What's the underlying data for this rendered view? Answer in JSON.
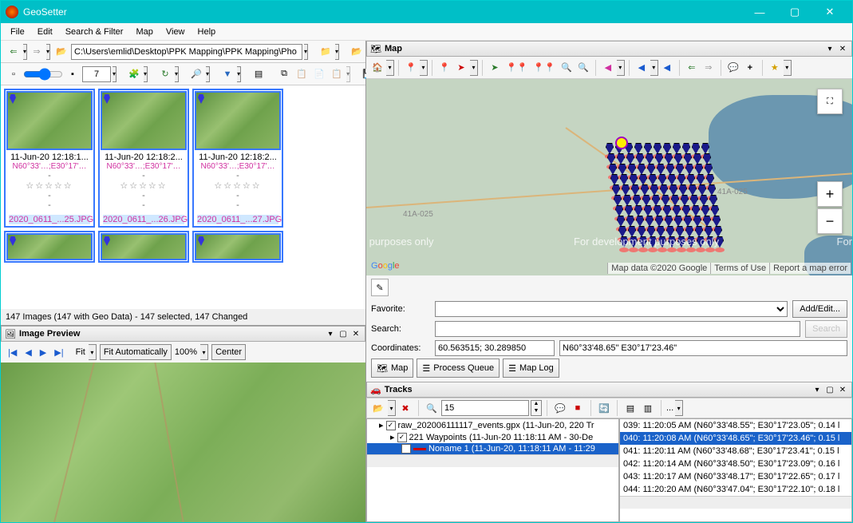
{
  "window": {
    "title": "GeoSetter"
  },
  "menu": [
    "File",
    "Edit",
    "Search & Filter",
    "Map",
    "View",
    "Help"
  ],
  "path_bar": {
    "value": "C:\\Users\\emlid\\Desktop\\PPK Mapping\\PPK Mapping\\Pho"
  },
  "zoom": {
    "value": "7"
  },
  "thumbnails": [
    {
      "date": "11-Jun-20 12:18:1...",
      "geo": "N60°33'…;E30°17'…",
      "file": "2020_0611_...25.JPG"
    },
    {
      "date": "11-Jun-20 12:18:2...",
      "geo": "N60°33'…;E30°17'…",
      "file": "2020_0611_...26.JPG"
    },
    {
      "date": "11-Jun-20 12:18:2...",
      "geo": "N60°33'…;E30°17'…",
      "file": "2020_0611_...27.JPG"
    }
  ],
  "status": "147 Images (147 with Geo Data) - 147 selected, 147 Changed",
  "preview": {
    "header": "Image Preview",
    "fit_label": "Fit",
    "fit_mode": "Fit Automatically",
    "zoom": "100%",
    "center": "Center"
  },
  "map": {
    "header": "Map",
    "road_label": "41A-025",
    "dev_only": "For development purposes only",
    "attrib": [
      "Map data ©2020 Google",
      "Terms of Use",
      "Report a map error"
    ]
  },
  "mid": {
    "favorite_label": "Favorite:",
    "search_label": "Search:",
    "coords_label": "Coordinates:",
    "add_edit": "Add/Edit...",
    "search_btn": "Search",
    "coords_dec": "60.563515; 30.289850",
    "coords_dms": "N60°33'48.65\" E30°17'23.46\"",
    "tab_map": "Map",
    "tab_queue": "Process Queue",
    "tab_log": "Map Log"
  },
  "tracks": {
    "header": "Tracks",
    "spin": "15",
    "tree": {
      "gpx": "raw_202006111117_events.gpx (11-Jun-20, 220 Tr",
      "wp": "221 Waypoints (11-Jun-20 11:18:11 AM - 30-De",
      "noname": "Noname 1 (11-Jun-20, 11:18:11 AM - 11:29"
    },
    "list": [
      "039: 11:20:05 AM (N60°33'48.55\"; E30°17'23.05\"; 0.14 l",
      "040: 11:20:08 AM (N60°33'48.65\"; E30°17'23.46\"; 0.15 l",
      "041: 11:20:11 AM (N60°33'48.68\"; E30°17'23.41\"; 0.15 l",
      "042: 11:20:14 AM (N60°33'48.50\"; E30°17'23.09\"; 0.16 l",
      "043: 11:20:17 AM (N60°33'48.17\"; E30°17'22.65\"; 0.17 l",
      "044: 11:20:20 AM (N60°33'47.04\"; E30°17'22.10\"; 0.18 l"
    ],
    "list_selected_index": 1
  }
}
